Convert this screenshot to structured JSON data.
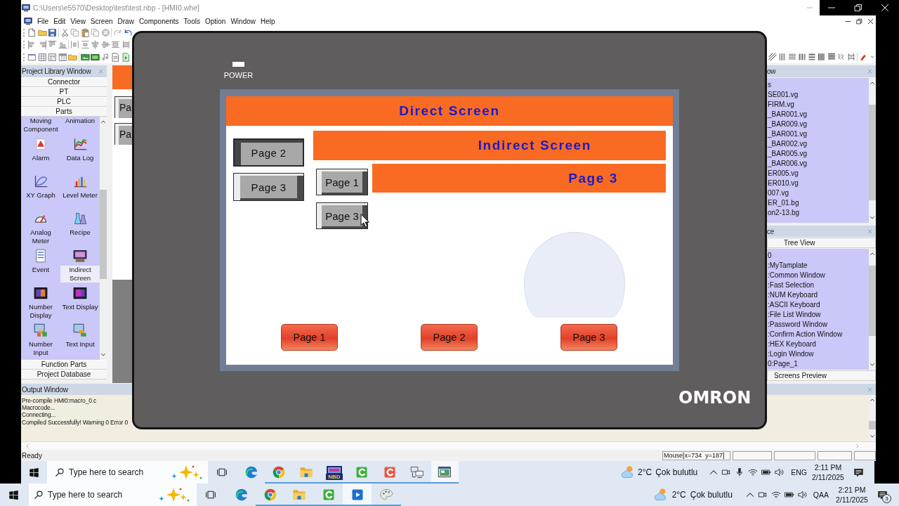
{
  "app_window": {
    "title": "C:\\Users\\e5570\\Desktop\\test\\test.nbp - [HMI0.whe]",
    "menu": [
      "File",
      "Edit",
      "View",
      "Screen",
      "Draw",
      "Components",
      "Tools",
      "Option",
      "Window",
      "Help"
    ],
    "library": {
      "title": "Project Library Window",
      "categories": [
        "Connector",
        "PT",
        "PLC",
        "Parts"
      ],
      "top_labels": [
        "Moving Component",
        "Animation"
      ],
      "items": [
        {
          "label": "Alarm",
          "selected": false
        },
        {
          "label": "Data Log",
          "selected": false
        },
        {
          "label": "XY Graph",
          "selected": false
        },
        {
          "label": "Level Meter",
          "selected": false
        },
        {
          "label": "Analog Meter",
          "selected": false
        },
        {
          "label": "Recipe",
          "selected": false
        },
        {
          "label": "Event",
          "selected": false
        },
        {
          "label": "Indirect Screen",
          "selected": true
        },
        {
          "label": "Number Display",
          "selected": false
        },
        {
          "label": "Text Display",
          "selected": false
        },
        {
          "label": "Number Input",
          "selected": false
        },
        {
          "label": "Text Input",
          "selected": false
        }
      ],
      "footer_tabs": [
        "Function Parts",
        "Project Database"
      ]
    },
    "canvas": {
      "buttons": [
        "Pa",
        "Pa"
      ]
    },
    "file_panel": {
      "title": "ow",
      "files": [
        "s",
        "SE001.vg",
        "FIRM.vg",
        "_BAR001.vg",
        "_BAR009.vg",
        "_BAR001.vg",
        "_BAR002.vg",
        "_BAR005.vg",
        "_BAR006.vg",
        "ER005.vg",
        "ER010.vg",
        "007.vg",
        "ER_01.bg",
        "on2-13.bg"
      ]
    },
    "screen_panel": {
      "title": "ce",
      "tab": "Tree View",
      "entries": [
        "0",
        ":MyTamplate",
        ":Common Window",
        ":Fast Selection",
        ":NUM Keyboard",
        ":ASCII Keyboard",
        ":File List Window",
        ":Password Window",
        ":Confirm Action Window",
        ":HEX Keyboard",
        ":Login Window",
        "0:Page_1"
      ],
      "footer_tab": "Screens Preview"
    },
    "output": {
      "title": "Output Window",
      "lines": [
        "Pre-compile HMI0:macro_0.c",
        "Macrocode...",
        "Connecting...",
        "Compiled Successfully! Warning 0 Error 0"
      ]
    },
    "status_bar": {
      "message": "Ready",
      "mouse": "Mouse[x=734  y=187]"
    }
  },
  "simulator": {
    "power_led_on": true,
    "power_label": "POWER",
    "screen": {
      "title": "Direct Screen",
      "buttons": [
        {
          "label": "Page 2",
          "pressed": true
        },
        {
          "label": "Page 3",
          "pressed": false
        }
      ],
      "indirect": {
        "title": "Indirect Screen",
        "buttons": [
          "Page 1",
          "Page 3"
        ],
        "page_title": "Page 3"
      },
      "nav_buttons": [
        "Page 1",
        "Page 2",
        "Page 3"
      ]
    },
    "brand": "OMRON"
  },
  "taskbars": [
    {
      "search": {
        "placeholder": "Type here to search"
      },
      "apps": [
        {
          "running": false,
          "selected": false
        },
        {
          "running": true,
          "selected": false
        },
        {
          "running": true,
          "selected": false
        },
        {
          "running": true,
          "selected": false,
          "icon_text": "NBD"
        },
        {
          "running": true,
          "selected": false
        },
        {
          "running": true,
          "selected": false
        },
        {
          "running": true,
          "selected": false
        },
        {
          "running": true,
          "selected": true
        }
      ],
      "weather": {
        "temp": "2°C",
        "condition": "Çok bulutlu"
      },
      "language": "ENG",
      "time": "2:11 PM",
      "date": "2/11/2025"
    },
    {
      "search": {
        "placeholder": "Type here to search"
      },
      "apps": [
        {
          "running": false,
          "selected": false
        },
        {
          "running": true,
          "selected": false
        },
        {
          "running": true,
          "selected": false
        },
        {
          "running": true,
          "selected": false
        },
        {
          "running": true,
          "selected": true
        },
        {
          "running": true,
          "selected": false
        }
      ],
      "weather": {
        "temp": "2°C",
        "condition": "Çok bulutlu"
      },
      "language": "QAA",
      "time": "2:21 PM",
      "date": "2/11/2025",
      "notification_count": "3"
    }
  ]
}
